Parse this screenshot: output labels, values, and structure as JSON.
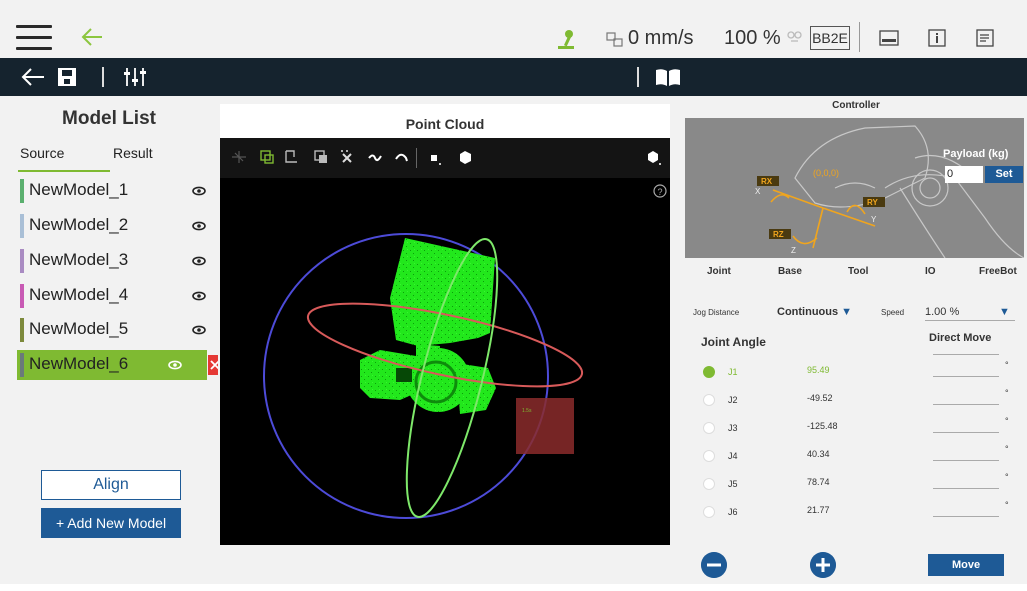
{
  "topbar": {
    "speed": "0 mm/s",
    "percent": "100 %",
    "badge": "BB2E"
  },
  "left_panel": {
    "title": "Model List",
    "tabs": [
      "Source",
      "Result"
    ],
    "models": [
      {
        "label": "NewModel_1",
        "color": "#5aaf6e"
      },
      {
        "label": "NewModel_2",
        "color": "#a9bfd6"
      },
      {
        "label": "NewModel_3",
        "color": "#a98bc2"
      },
      {
        "label": "NewModel_4",
        "color": "#c85ab4"
      },
      {
        "label": "NewModel_5",
        "color": "#7d8a3c"
      },
      {
        "label": "NewModel_6",
        "color": "#6a7a7a",
        "selected": true
      }
    ],
    "align_label": "Align",
    "add_label": "+ Add New Model"
  },
  "point_cloud": {
    "title": "Point Cloud",
    "help_glyph": "?",
    "roi_label": "1.5s"
  },
  "controller": {
    "title": "Controller",
    "payload_label": "Payload (kg)",
    "payload_value": "0",
    "set_label": "Set",
    "axes": {
      "rx": "RX",
      "ry": "RY",
      "rz": "RZ",
      "origin": "(0,0,0)",
      "x": "X",
      "y": "Y",
      "z": "Z"
    },
    "modes": [
      "Joint",
      "Base",
      "Tool",
      "IO",
      "FreeBot"
    ],
    "jog_distance_label": "Jog Distance",
    "jog_distance_value": "Continuous",
    "speed_label": "Speed",
    "speed_value": "1.00 %",
    "joint_angle_title": "Joint Angle",
    "direct_move_title": "Direct Move",
    "degree_symbol": "°",
    "joints": [
      {
        "name": "J1",
        "value": "95.49",
        "active": true
      },
      {
        "name": "J2",
        "value": "-49.52",
        "active": false
      },
      {
        "name": "J3",
        "value": "-125.48",
        "active": false
      },
      {
        "name": "J4",
        "value": "40.34",
        "active": false
      },
      {
        "name": "J5",
        "value": "78.74",
        "active": false
      },
      {
        "name": "J6",
        "value": "21.77",
        "active": false
      }
    ],
    "move_label": "Move"
  },
  "colors": {
    "accent_green": "#7fba32",
    "primary_blue": "#1e5a96",
    "dark_toolbar": "#15232e",
    "cloud_green": "#22e81c"
  }
}
